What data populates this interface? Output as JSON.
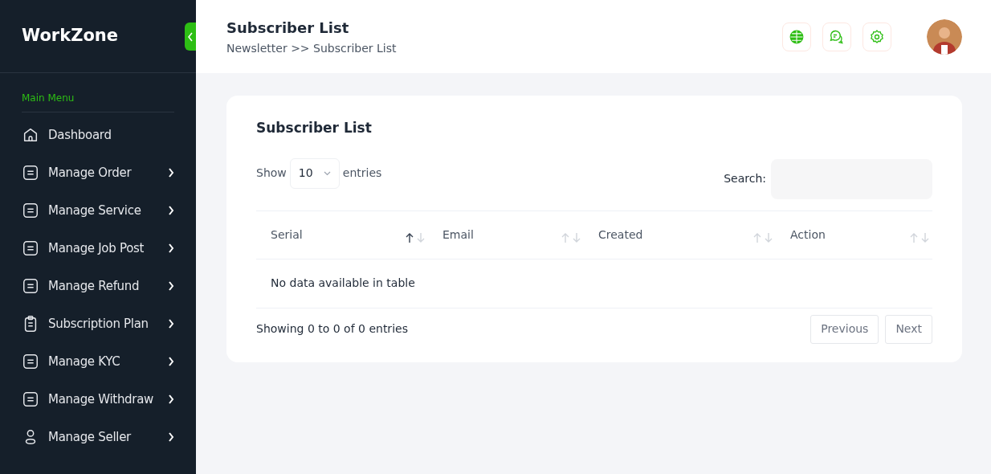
{
  "brand": "WorkZone",
  "sidebar": {
    "section": "Main Menu",
    "items": [
      {
        "label": "Dashboard",
        "kind": "home",
        "expandable": false
      },
      {
        "label": "Manage Order",
        "kind": "doc",
        "expandable": true
      },
      {
        "label": "Manage Service",
        "kind": "doc",
        "expandable": true
      },
      {
        "label": "Manage Job Post",
        "kind": "doc",
        "expandable": true
      },
      {
        "label": "Manage Refund",
        "kind": "doc",
        "expandable": true
      },
      {
        "label": "Subscription Plan",
        "kind": "clipboard",
        "expandable": true
      },
      {
        "label": "Manage KYC",
        "kind": "doc",
        "expandable": true
      },
      {
        "label": "Manage Withdraw",
        "kind": "doc",
        "expandable": true
      },
      {
        "label": "Manage Seller",
        "kind": "user",
        "expandable": true
      }
    ]
  },
  "header": {
    "title": "Subscriber List",
    "breadcrumb": "Newsletter >> Subscriber List"
  },
  "card": {
    "title": "Subscriber List",
    "show_label": "Show",
    "page_size": "10",
    "entries_label": "entries",
    "search_label": "Search:",
    "columns": [
      {
        "label": "Serial",
        "sorted": true
      },
      {
        "label": "Email",
        "sorted": false
      },
      {
        "label": "Created",
        "sorted": false
      },
      {
        "label": "Action",
        "sorted": false
      }
    ],
    "empty_message": "No data available in table",
    "info": "Showing 0 to 0 of 0 entries",
    "pagination": [
      {
        "label": "Previous"
      },
      {
        "label": "Next"
      }
    ]
  }
}
